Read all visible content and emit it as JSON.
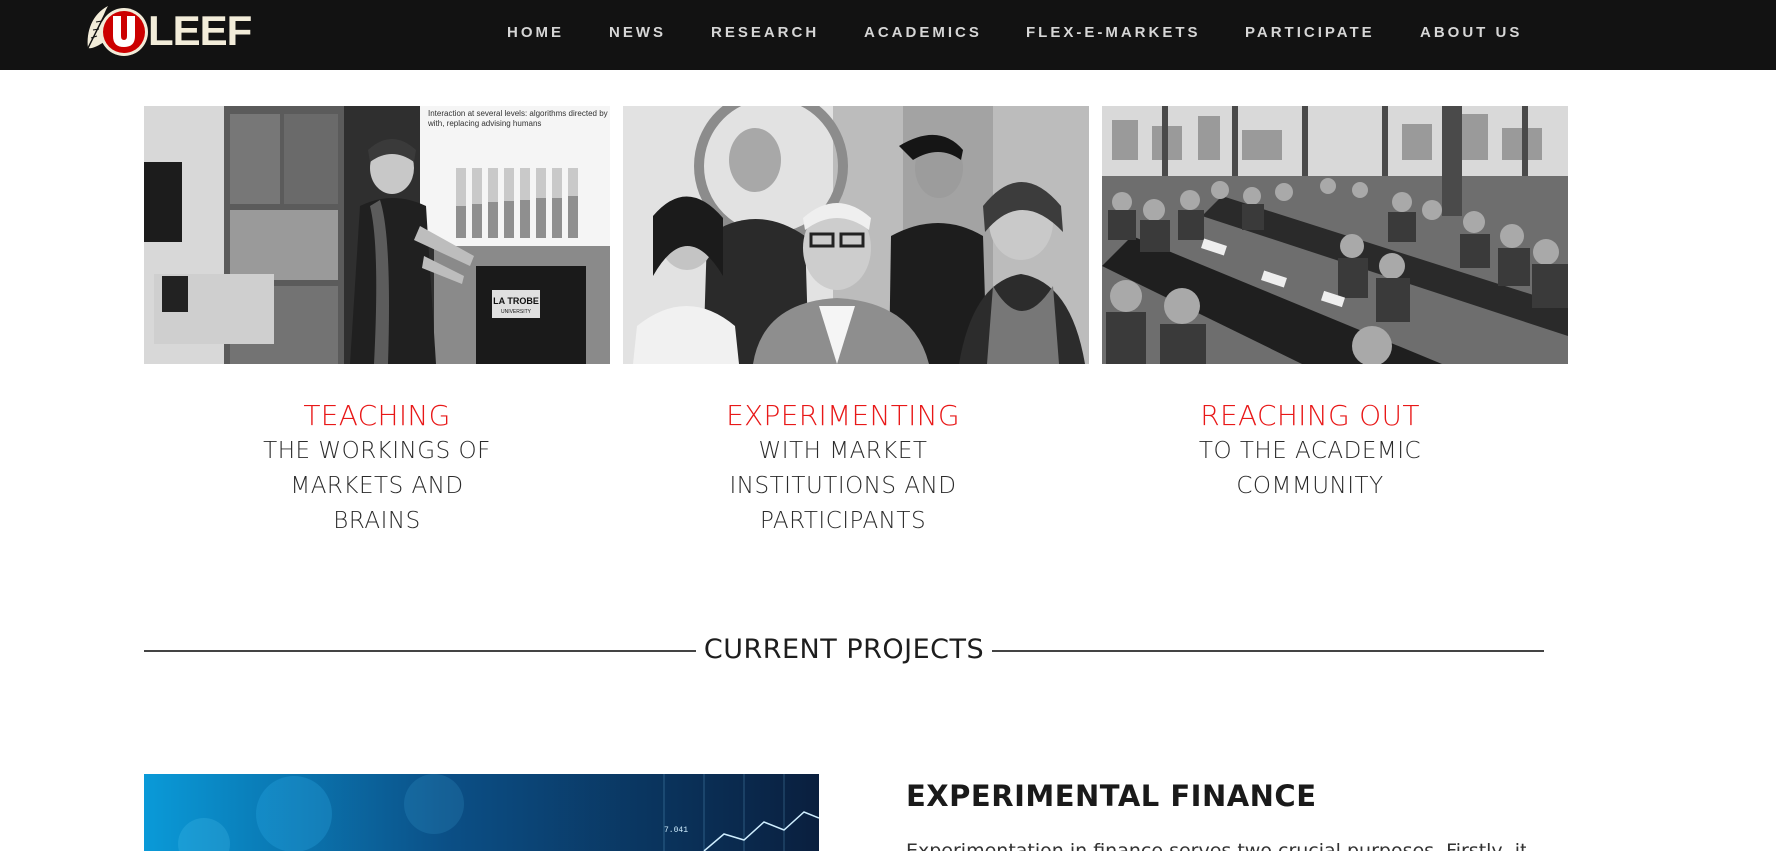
{
  "header": {
    "logo_text": "LEEF",
    "logo_letter": "U",
    "brand_red": "#cc0000",
    "nav": [
      {
        "label": "HOME"
      },
      {
        "label": "NEWS"
      },
      {
        "label": "RESEARCH"
      },
      {
        "label": "ACADEMICS"
      },
      {
        "label": "FLEX-E-MARKETS"
      },
      {
        "label": "PARTICIPATE"
      },
      {
        "label": "ABOUT US"
      }
    ]
  },
  "features": [
    {
      "title": "TEACHING",
      "lines": [
        "THE WORKINGS OF",
        "MARKETS AND",
        "BRAINS"
      ]
    },
    {
      "title": "EXPERIMENTING",
      "lines": [
        "WITH MARKET",
        "INSTITUTIONS AND",
        "PARTICIPANTS"
      ]
    },
    {
      "title": "REACHING OUT",
      "lines": [
        "TO THE ACADEMIC",
        "COMMUNITY"
      ]
    }
  ],
  "photo_text": {
    "slide_line1": "Interaction at several levels: algorithms directed by",
    "slide_line2": "with, replacing advising humans",
    "podium": "LA TROBE",
    "podium_sub": "UNIVERSITY",
    "graph_label": "7.041"
  },
  "section": {
    "heading": "CURRENT PROJECTS"
  },
  "project": {
    "title": "EXPERIMENTAL FINANCE",
    "text_partial": "Experimentation in finance serves two crucial purposes. Firstly, it"
  },
  "colors": {
    "accent_red": "#e81818",
    "topbar": "#121212",
    "nav_text": "#d6d6d6"
  }
}
